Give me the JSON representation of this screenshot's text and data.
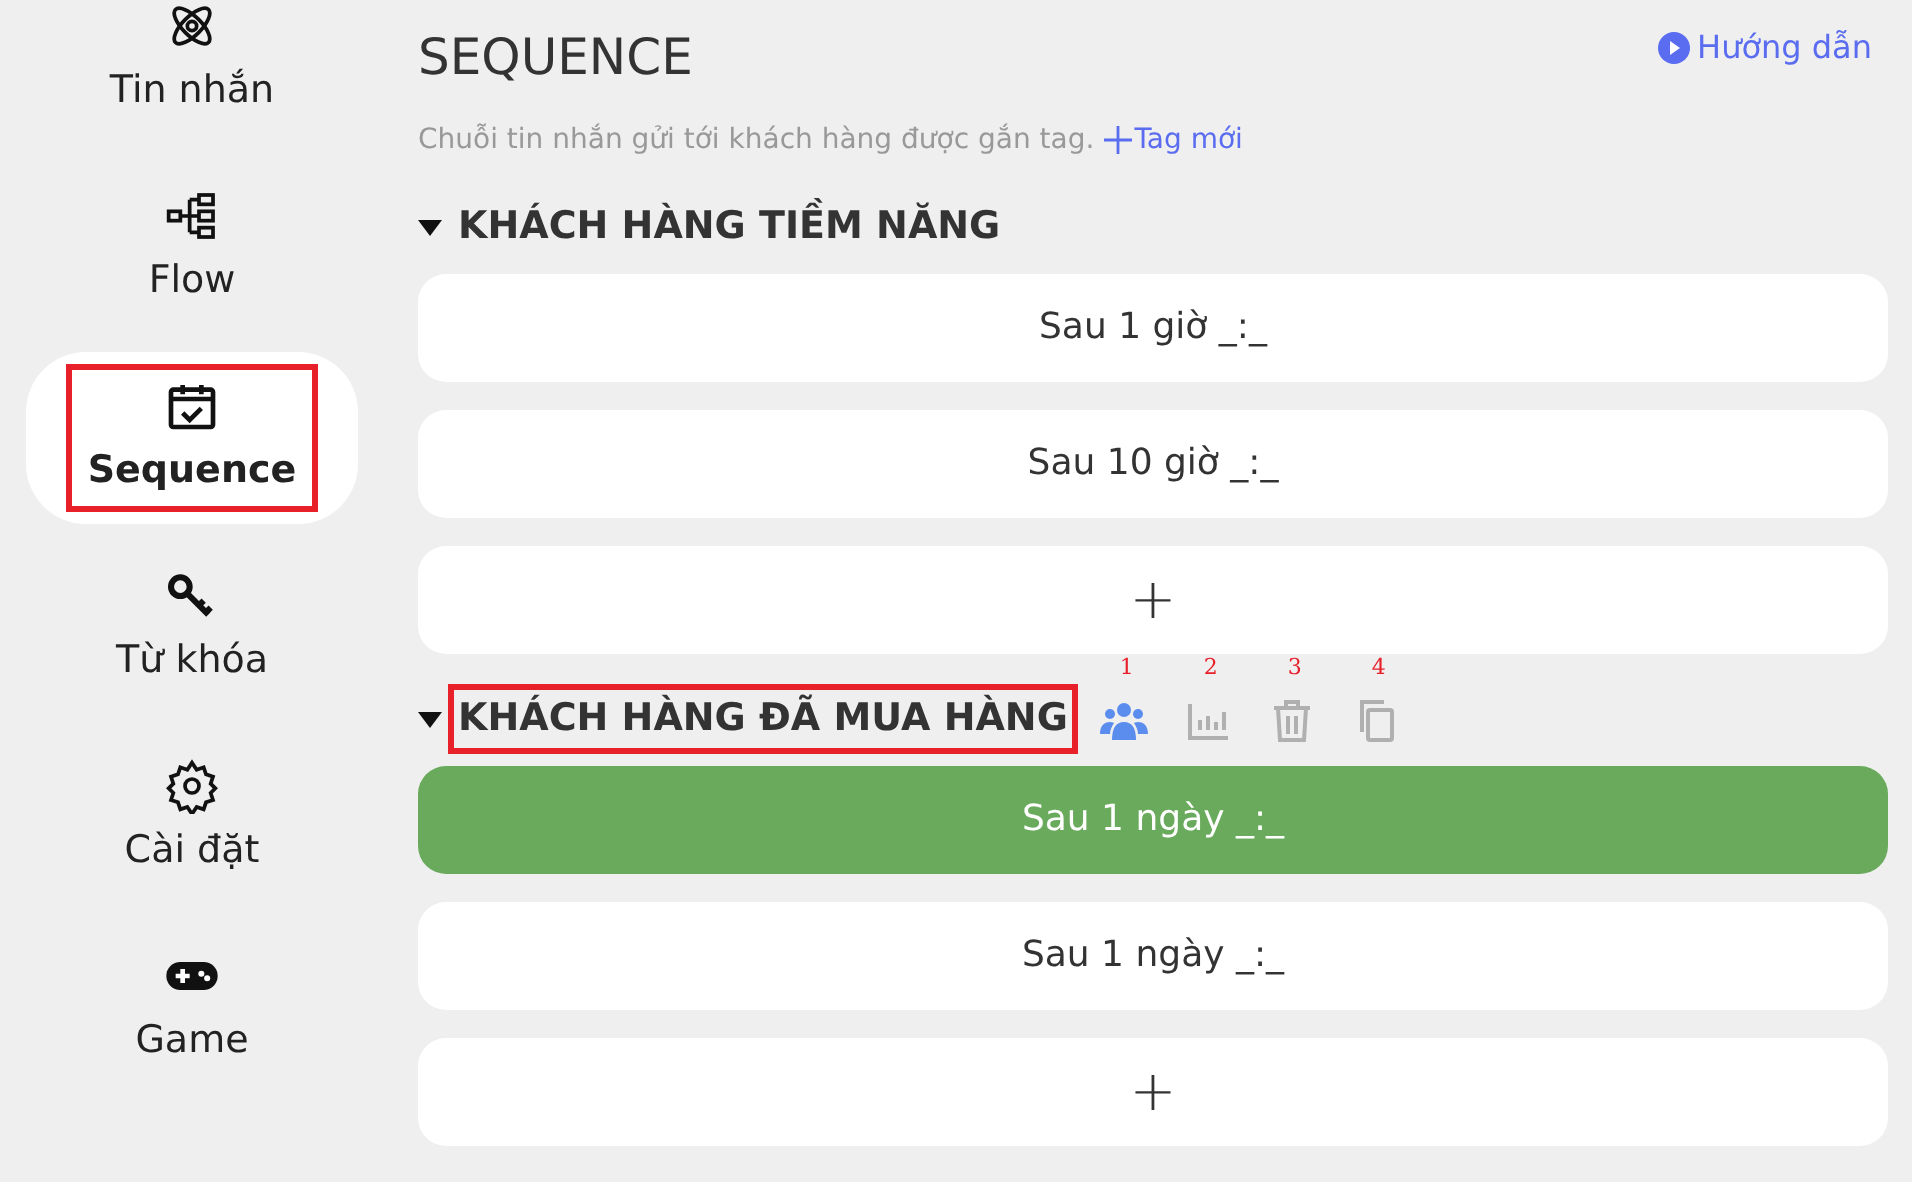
{
  "sidebar": {
    "items": [
      {
        "kind": "atom",
        "label": "Tin nhắn",
        "selected": false,
        "highlighted": false
      },
      {
        "kind": "flow",
        "label": "Flow",
        "selected": false,
        "highlighted": false
      },
      {
        "kind": "calendar",
        "label": "Sequence",
        "selected": true,
        "highlighted": true
      },
      {
        "kind": "key",
        "label": "Từ khóa",
        "selected": false,
        "highlighted": false
      },
      {
        "kind": "gear",
        "label": "Cài đặt",
        "selected": false,
        "highlighted": false
      },
      {
        "kind": "gamepad",
        "label": "Game",
        "selected": false,
        "highlighted": false
      }
    ]
  },
  "header": {
    "title": "SEQUENCE",
    "guide_link": "Hướng dẫn",
    "description": "Chuỗi tin nhắn gửi tới khách hàng được gắn tag.",
    "new_tag_link": "Tag mới"
  },
  "groups": [
    {
      "name": "KHÁCH HÀNG TIỀM NĂNG",
      "expanded": true,
      "highlighted": false,
      "steps": [
        {
          "kind": "step",
          "label": "Sau 1 giờ _:_",
          "selected": false
        },
        {
          "kind": "step",
          "label": "Sau 10 giờ _:_",
          "selected": false
        },
        {
          "kind": "add",
          "label": "+",
          "selected": false
        }
      ]
    },
    {
      "name": "KHÁCH HÀNG ĐÃ MUA HÀNG",
      "expanded": true,
      "highlighted": true,
      "tools": [
        {
          "kind": "users",
          "callout": "1",
          "active": true
        },
        {
          "kind": "chart",
          "callout": "2",
          "active": false
        },
        {
          "kind": "trash",
          "callout": "3",
          "active": false
        },
        {
          "kind": "copy",
          "callout": "4",
          "active": false
        }
      ],
      "steps": [
        {
          "kind": "step",
          "label": "Sau 1 ngày _:_",
          "selected": true
        },
        {
          "kind": "step",
          "label": "Sau 1 ngày _:_",
          "selected": false
        },
        {
          "kind": "add",
          "label": "+",
          "selected": false
        }
      ]
    }
  ]
}
